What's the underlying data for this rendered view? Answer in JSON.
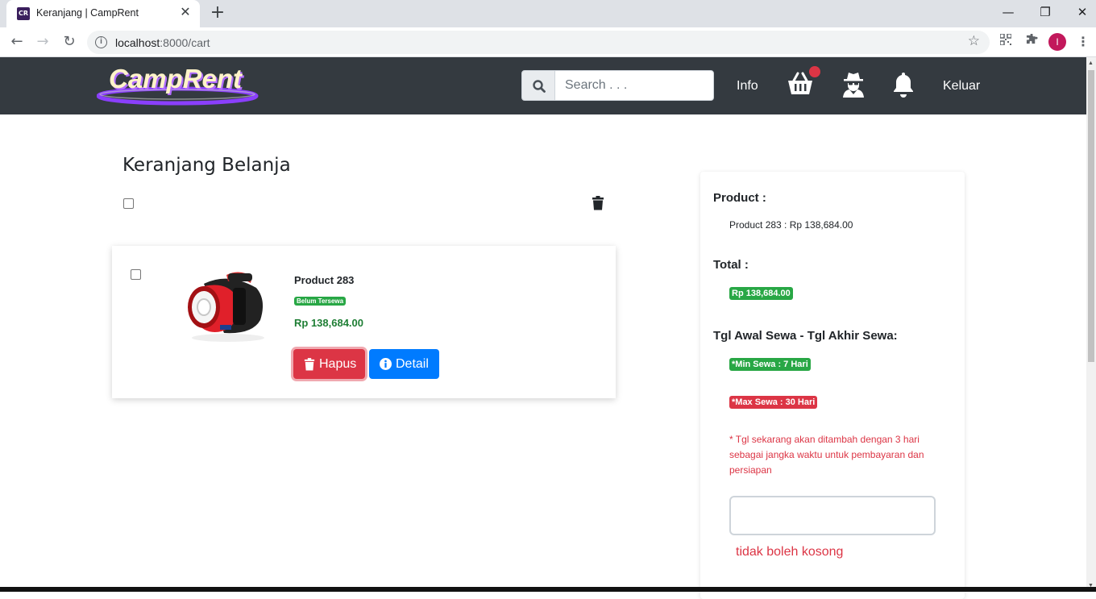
{
  "browser": {
    "tab_title": "Keranjang | CampRent",
    "favicon_text": "CR",
    "url_host": "localhost",
    "url_rest": ":8000/cart",
    "profile_initial": "I"
  },
  "navbar": {
    "logo_text": "CampRent",
    "search_placeholder": "Search . . .",
    "info_label": "Info",
    "logout_label": "Keluar"
  },
  "cart": {
    "title": "Keranjang Belanja",
    "items": [
      {
        "name": "Product 283",
        "status": "Belum Tersewa",
        "price": "Rp 138,684.00",
        "delete_label": "Hapus",
        "detail_label": "Detail"
      }
    ]
  },
  "summary": {
    "product_heading": "Product :",
    "product_line": "Product 283 : Rp 138,684.00",
    "total_heading": "Total :",
    "total_value": "Rp 138,684.00",
    "date_heading": "Tgl Awal Sewa - Tgl Akhir Sewa:",
    "min_badge": "*Min Sewa : 7 Hari",
    "max_badge": "*Max Sewa : 30 Hari",
    "note": "* Tgl sekarang akan ditambah dengan 3 hari sebagai jangka waktu untuk pembayaran dan persiapan",
    "date_value": "",
    "error": "tidak boleh kosong"
  },
  "colors": {
    "navbar": "#343a40",
    "success": "#28a745",
    "danger": "#dc3545",
    "primary": "#007bff",
    "logo_purple": "#8a3ffc"
  }
}
